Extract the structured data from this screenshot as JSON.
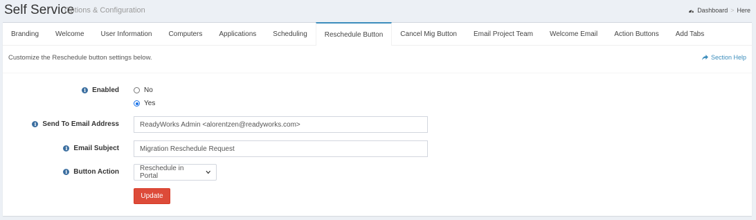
{
  "header": {
    "title": "Self Service",
    "subtitle": "Options & Configuration",
    "breadcrumb": {
      "dashboard": "Dashboard",
      "separator": ">",
      "current": "Here"
    }
  },
  "tabs": [
    {
      "label": "Branding"
    },
    {
      "label": "Welcome"
    },
    {
      "label": "User Information"
    },
    {
      "label": "Computers"
    },
    {
      "label": "Applications"
    },
    {
      "label": "Scheduling"
    },
    {
      "label": "Reschedule Button",
      "active": true
    },
    {
      "label": "Cancel Mig Button"
    },
    {
      "label": "Email Project Team"
    },
    {
      "label": "Welcome Email"
    },
    {
      "label": "Action Buttons"
    },
    {
      "label": "Add Tabs"
    }
  ],
  "description": "Customize the Reschedule button settings below.",
  "section_help": "Section Help",
  "form": {
    "enabled": {
      "label": "Enabled",
      "options": [
        {
          "label": "No",
          "checked": false
        },
        {
          "label": "Yes",
          "checked": true
        }
      ]
    },
    "send_to": {
      "label": "Send To Email Address",
      "value": "ReadyWorks Admin <alorentzen@readyworks.com>"
    },
    "subject": {
      "label": "Email Subject",
      "value": "Migration Reschedule Request"
    },
    "action": {
      "label": "Button Action",
      "value": "Reschedule in Portal"
    },
    "update_label": "Update"
  },
  "colors": {
    "accent": "#3c8dbc",
    "danger": "#dd4b39",
    "background": "#ecf0f5"
  }
}
